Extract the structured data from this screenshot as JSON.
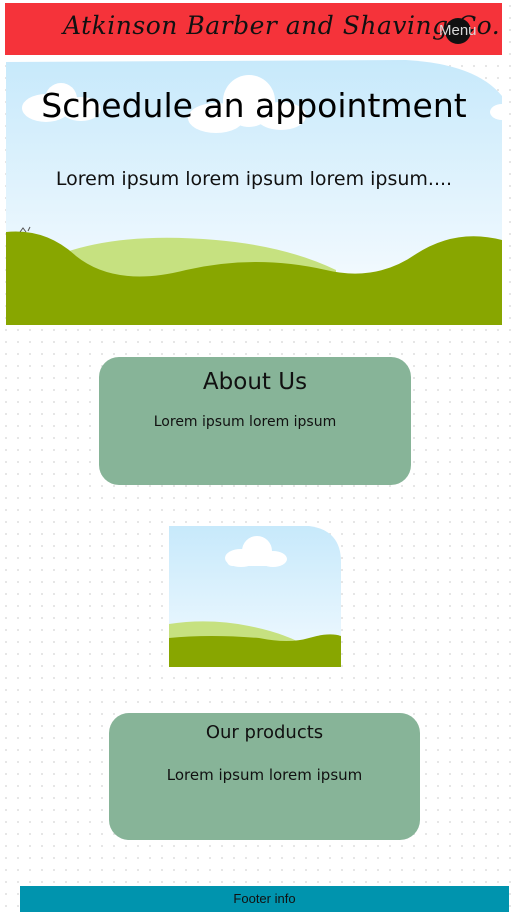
{
  "header": {
    "logo_text": "Atkinson Barber and Shaving Co.",
    "menu_label": "Menu",
    "background": "#f5333a"
  },
  "hero": {
    "title": "Schedule an appointment",
    "subtitle": "Lorem ipsum lorem ipsum lorem ipsum...."
  },
  "about": {
    "title": "About Us",
    "body": "Lorem ipsum lorem ipsum"
  },
  "image_placeholder": {
    "icon": "landscape-image-icon"
  },
  "products": {
    "title": "Our products",
    "body": "Lorem ipsum lorem ipsum"
  },
  "footer": {
    "text": "Footer info"
  },
  "colors": {
    "accent_red": "#f5333a",
    "card_green": "#87b498",
    "hill_green": "#88a600",
    "light_hill": "#c6e180",
    "sky_top": "#c7e9fb",
    "footer_teal": "#0094ae"
  }
}
